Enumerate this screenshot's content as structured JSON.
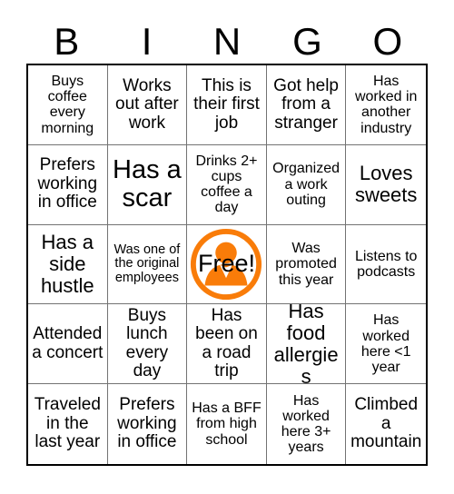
{
  "card": {
    "header_letters": [
      "B",
      "I",
      "N",
      "G",
      "O"
    ],
    "accent_color": "#F97C09",
    "grid_line_color": "#737373",
    "border_color": "#000000",
    "background_color": "#FFFFFF",
    "text_color": "#000000",
    "rows": 5,
    "columns": 5
  },
  "free_space": {
    "label": "Free!",
    "icon": "person-silhouette-in-circle-icon",
    "color": "#F97C09"
  },
  "squares": [
    {
      "id": "b1",
      "text": "Buys coffee every morning",
      "size": "sm"
    },
    {
      "id": "i1",
      "text": "Works out after work",
      "size": "md"
    },
    {
      "id": "n1",
      "text": "This is their first job",
      "size": "md"
    },
    {
      "id": "g1",
      "text": "Got help from a stranger",
      "size": "md"
    },
    {
      "id": "o1",
      "text": "Has worked in another industry",
      "size": "sm"
    },
    {
      "id": "b2",
      "text": "Prefers working in office",
      "size": "md"
    },
    {
      "id": "i2",
      "text": "Has a scar",
      "size": "xl"
    },
    {
      "id": "n2",
      "text": "Drinks 2+ cups coffee a day",
      "size": "sm"
    },
    {
      "id": "g2",
      "text": "Organized a work outing",
      "size": "sm"
    },
    {
      "id": "o2",
      "text": "Loves sweets",
      "size": "lg"
    },
    {
      "id": "b3",
      "text": "Has a side hustle",
      "size": "lg"
    },
    {
      "id": "i3",
      "text": "Was one of the original employees",
      "size": "xs"
    },
    {
      "id": "n3",
      "text": "Free!",
      "size": "free"
    },
    {
      "id": "g3",
      "text": "Was promoted this year",
      "size": "sm"
    },
    {
      "id": "o3",
      "text": "Listens to podcasts",
      "size": "sm"
    },
    {
      "id": "b4",
      "text": "Attended a concert",
      "size": "md"
    },
    {
      "id": "i4",
      "text": "Buys lunch every day",
      "size": "md"
    },
    {
      "id": "n4",
      "text": "Has been on a road trip",
      "size": "md"
    },
    {
      "id": "g4",
      "text": "Has food allergies",
      "size": "lg"
    },
    {
      "id": "o4",
      "text": "Has worked here <1 year",
      "size": "sm"
    },
    {
      "id": "b5",
      "text": "Traveled in the last year",
      "size": "md"
    },
    {
      "id": "i5",
      "text": "Prefers working in office",
      "size": "md"
    },
    {
      "id": "n5",
      "text": "Has a BFF from high school",
      "size": "sm"
    },
    {
      "id": "g5",
      "text": "Has worked here 3+ years",
      "size": "sm"
    },
    {
      "id": "o5",
      "text": "Climbed a mountain",
      "size": "md"
    }
  ]
}
